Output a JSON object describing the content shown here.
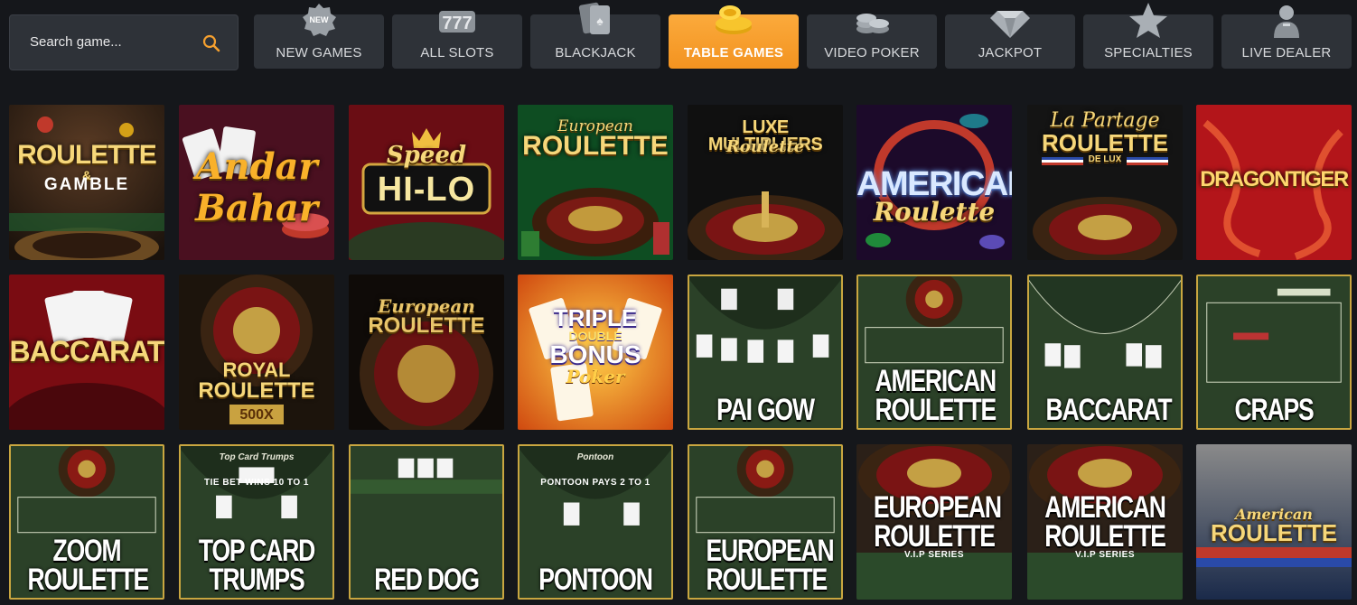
{
  "search": {
    "placeholder": "Search game..."
  },
  "categories": [
    {
      "label": "NEW GAMES",
      "icon": "new-badge-icon",
      "active": false
    },
    {
      "label": "ALL SLOTS",
      "icon": "slot-777-icon",
      "active": false
    },
    {
      "label": "BLACKJACK",
      "icon": "cards-icon",
      "active": false
    },
    {
      "label": "TABLE GAMES",
      "icon": "coin-stack-icon",
      "active": true
    },
    {
      "label": "VIDEO POKER",
      "icon": "chips-icon",
      "active": false
    },
    {
      "label": "JACKPOT",
      "icon": "diamond-icon",
      "active": false
    },
    {
      "label": "SPECIALTIES",
      "icon": "star-icon",
      "active": false
    },
    {
      "label": "LIVE DEALER",
      "icon": "dealer-icon",
      "active": false
    }
  ],
  "colors": {
    "accent": "#f5a02f",
    "background": "#15171b",
    "button": "#2e3238",
    "frame_gold": "#c9a640"
  },
  "games": [
    {
      "line1": "ROULETTE",
      "line2": "&",
      "line3": "GAMBLE"
    },
    {
      "line1": "Andar",
      "line2": "Bahar"
    },
    {
      "line1": "Speed",
      "line2": "HI-LO"
    },
    {
      "line1": "European",
      "line2": "ROULETTE"
    },
    {
      "line1": "LUXE MULTIPLIERS",
      "line2": "Roulette"
    },
    {
      "line1": "AMERICAN",
      "line2": "Roulette"
    },
    {
      "line1": "La Partage",
      "line2": "ROULETTE",
      "line3": "DE LUX"
    },
    {
      "line1": "DRAGONTIGER"
    },
    {
      "line1": "BACCARAT"
    },
    {
      "line1": "ROYAL",
      "line2": "ROULETTE",
      "line3": "500X"
    },
    {
      "line1": "European",
      "line2": "ROULETTE"
    },
    {
      "line1": "TRIPLE",
      "line2": "DOUBLE",
      "line3": "BONUS",
      "line4": "Poker"
    },
    {
      "line1": "PAI GOW"
    },
    {
      "line1": "AMERICAN",
      "line2": "ROULETTE"
    },
    {
      "line1": "BACCARAT"
    },
    {
      "line1": "CRAPS"
    },
    {
      "line1": "ZOOM",
      "line2": "ROULETTE"
    },
    {
      "line1": "TOP CARD",
      "line2": "TRUMPS",
      "line3": "Top Card Trumps",
      "line4": "TIE BET WINS 10 TO 1"
    },
    {
      "line1": "RED DOG"
    },
    {
      "line1": "PONTOON",
      "line2": "Pontoon",
      "line3": "PONTOON PAYS 2 TO 1"
    },
    {
      "line1": "EUROPEAN",
      "line2": "ROULETTE"
    },
    {
      "line1": "EUROPEAN",
      "line2": "ROULETTE",
      "line3": "V.I.P SERIES"
    },
    {
      "line1": "AMERICAN",
      "line2": "ROULETTE",
      "line3": "V.I.P SERIES"
    },
    {
      "line1": "American",
      "line2": "ROULETTE"
    }
  ]
}
